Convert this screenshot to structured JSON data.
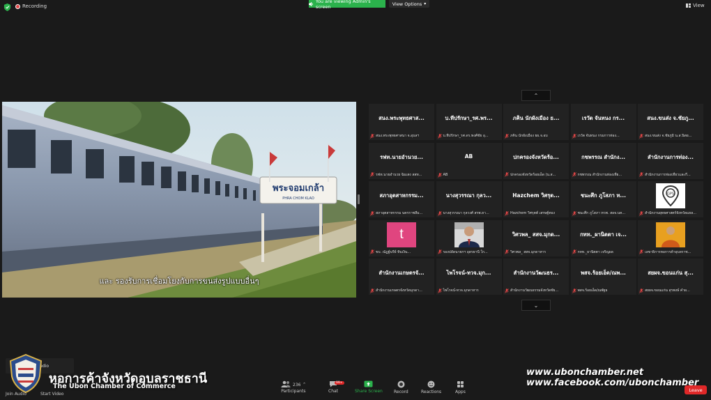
{
  "topbar": {
    "recording_label": "Recording",
    "viewing_label": "You are viewing Admin's screen",
    "view_options_label": "View Options",
    "view_label": "View"
  },
  "shared_screen": {
    "station_sign_thai": "พระจอมเกล้า",
    "station_sign_latin": "PHRA CHOM KLAO",
    "caption": "และ รองรับการเชื่อมโยงกับการขนส่งรูปแบบอื่นๆ"
  },
  "gallery": {
    "tiles": [
      {
        "main": "สนง.พระพุทธศาส...",
        "sub": "สนง.พระพุทธศาสนา จ.อุบลฯ"
      },
      {
        "main": "บ.ทีปรักษา_รศ.พร...",
        "sub": "บ.ทีปรักษา_รศ.ดร.พงศ์ชัย อุ..."
      },
      {
        "main": "ภคิน นักผังเมือง ย...",
        "sub": "ภคิน นักผังเมือง ยผ.จ.อบ"
      },
      {
        "main": "เรวัต จันทนง กร...",
        "sub": "เรวัต จันทนง กรมการท่อง..."
      },
      {
        "main": "สนง.ขนส่ง จ.ชัยภู...",
        "sub": "สนง.ขนส่ง จ.ชัยภูมิ น.ส.นิตย..."
      },
      {
        "main": "รฟท.นายอำนวย...",
        "sub": "รฟท.นายอำนวย ฉิมเสง สสท..."
      },
      {
        "main": "AB",
        "sub": "AB"
      },
      {
        "main": "ปกครองจังหวัดร้อ...",
        "sub": "ปกครองจังหวัดร้อยเอ็ด (น.ส..."
      },
      {
        "main": "กชพรรณ สำนักง...",
        "sub": "กชพรรณ สำนักงานท่องเที่ย..."
      },
      {
        "main": "สำนักงานการท่อง...",
        "sub": "สำนักงานการท่องเที่ยวและกี..."
      },
      {
        "main": "สภาอุตสาหกรรม...",
        "sub": "สภาอุตสาหกรรม นครราชสีม..."
      },
      {
        "main": "นางสุวรรณา กุลว...",
        "sub": "นางสุวรรณา กุลวงศ์ สรพ.ยา..."
      },
      {
        "main": "Hazchem วิศรุต...",
        "sub": "Hazchem วิศรุตต์ เสรษฐ์ทอง"
      },
      {
        "main": "ชนะศึก ภูโสภา ท...",
        "sub": "ชนะศึก ภูโสภา ทวพ. สอจ.นค..."
      },
      {
        "main": "",
        "sub": "สำนักงานยุทธศาสตร์จังหวัดแยล...",
        "pic": "gps"
      },
      {
        "main": "",
        "sub": "ขบ. ณัฏฐ์นรีย์ ทิมเงิน...",
        "pic": "t",
        "letter": "t"
      },
      {
        "main": "",
        "sub": "รองปลัดนายกฯ อุดรธานี ใก...",
        "pic": "person1"
      },
      {
        "main": "วิศวพล_ สสจ.มุกด...",
        "sub": "วิศวพล_ สสจ.มุกดาหาร"
      },
      {
        "main": "กทท._ผานิตตา เจ...",
        "sub": "กทท._ผานิตตา เจริญผล"
      },
      {
        "main": "",
        "sub": "เลขาธิการหอการค้าอุบลราช...",
        "pic": "person2"
      },
      {
        "main": "สำนักงานเกษตรจั...",
        "sub": "สำนักงานเกษตรจังหวัดมุกดา..."
      },
      {
        "main": "ไพโรจน์-ทวจ.มุก...",
        "sub": "ไพโรจน์-ทวจ.มุกดาหาร"
      },
      {
        "main": "สำนักงานวัฒนธร...",
        "sub": "สำนักงานวัฒนธรรมจังหวัดชัย..."
      },
      {
        "main": "พสจ.ร้อยเอ็ด/ณพ...",
        "sub": "พสจ.ร้อยเอ็ด/ณพัฐธ"
      },
      {
        "main": "สยผจ.ขอนแก่น สุ...",
        "sub": "สยผจ.ขอนแก่น สุรพงษ์ คำผ..."
      }
    ]
  },
  "toolbar": {
    "join_audio": "Join Audio",
    "start_video": "Start Video",
    "participants": "Participants",
    "participants_count": "236",
    "chat": "Chat",
    "chat_badge": "99+",
    "share_screen": "Share Screen",
    "record": "Record",
    "reactions": "Reactions",
    "apps": "Apps",
    "leave": "Leave",
    "audio_pill": "udio"
  },
  "watermark": {
    "chamber_thai": "หอการค้าจังหวัดอุบลราชธานี",
    "chamber_english": "The Ubon Chamber of Commerce",
    "website": "www.ubonchamber.net",
    "facebook": "www.facebook.com/ubonchamber"
  },
  "colors": {
    "share_green": "#2bb24c",
    "leave_red": "#e02828",
    "tile_bg": "#222222",
    "background": "#1a1a1a"
  }
}
